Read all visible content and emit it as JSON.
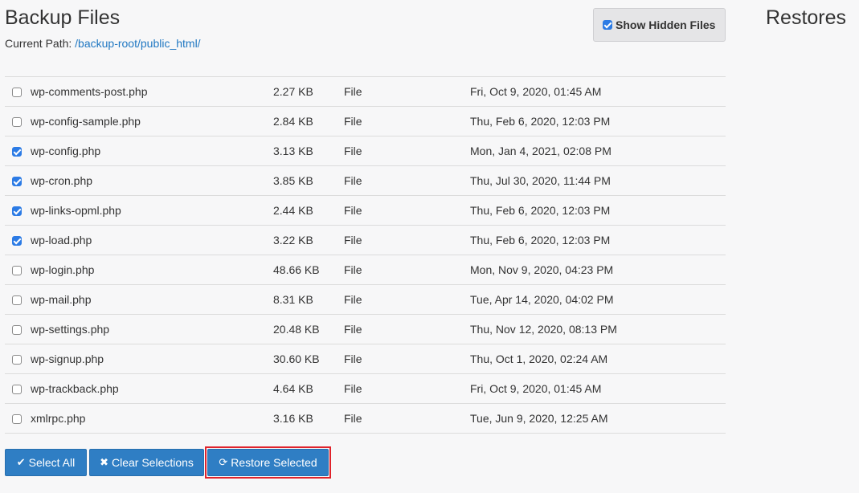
{
  "header": {
    "title": "Backup Files",
    "path_label": "Current Path:",
    "path_value": "/backup-root/public_html/",
    "show_hidden_label": "Show Hidden Files",
    "show_hidden_checked": true
  },
  "sidebar": {
    "title": "Restores"
  },
  "files": [
    {
      "name": "wp-comments-post.php",
      "size": "2.27 KB",
      "type": "File",
      "modified": "Fri, Oct 9, 2020, 01:45 AM",
      "checked": false
    },
    {
      "name": "wp-config-sample.php",
      "size": "2.84 KB",
      "type": "File",
      "modified": "Thu, Feb 6, 2020, 12:03 PM",
      "checked": false
    },
    {
      "name": "wp-config.php",
      "size": "3.13 KB",
      "type": "File",
      "modified": "Mon, Jan 4, 2021, 02:08 PM",
      "checked": true
    },
    {
      "name": "wp-cron.php",
      "size": "3.85 KB",
      "type": "File",
      "modified": "Thu, Jul 30, 2020, 11:44 PM",
      "checked": true
    },
    {
      "name": "wp-links-opml.php",
      "size": "2.44 KB",
      "type": "File",
      "modified": "Thu, Feb 6, 2020, 12:03 PM",
      "checked": true
    },
    {
      "name": "wp-load.php",
      "size": "3.22 KB",
      "type": "File",
      "modified": "Thu, Feb 6, 2020, 12:03 PM",
      "checked": true
    },
    {
      "name": "wp-login.php",
      "size": "48.66 KB",
      "type": "File",
      "modified": "Mon, Nov 9, 2020, 04:23 PM",
      "checked": false
    },
    {
      "name": "wp-mail.php",
      "size": "8.31 KB",
      "type": "File",
      "modified": "Tue, Apr 14, 2020, 04:02 PM",
      "checked": false
    },
    {
      "name": "wp-settings.php",
      "size": "20.48 KB",
      "type": "File",
      "modified": "Thu, Nov 12, 2020, 08:13 PM",
      "checked": false
    },
    {
      "name": "wp-signup.php",
      "size": "30.60 KB",
      "type": "File",
      "modified": "Thu, Oct 1, 2020, 02:24 AM",
      "checked": false
    },
    {
      "name": "wp-trackback.php",
      "size": "4.64 KB",
      "type": "File",
      "modified": "Fri, Oct 9, 2020, 01:45 AM",
      "checked": false
    },
    {
      "name": "xmlrpc.php",
      "size": "3.16 KB",
      "type": "File",
      "modified": "Tue, Jun 9, 2020, 12:25 AM",
      "checked": false
    }
  ],
  "actions": {
    "select_all_label": "Select All",
    "select_all_icon": "check-icon",
    "clear_label": "Clear Selections",
    "clear_icon": "times-icon",
    "restore_label": "Restore Selected",
    "restore_icon": "refresh-icon"
  },
  "colors": {
    "accent": "#2f7ec4",
    "link": "#1f77c2",
    "highlight": "#e0232b",
    "checkbox_checked": "#2c7be5"
  }
}
